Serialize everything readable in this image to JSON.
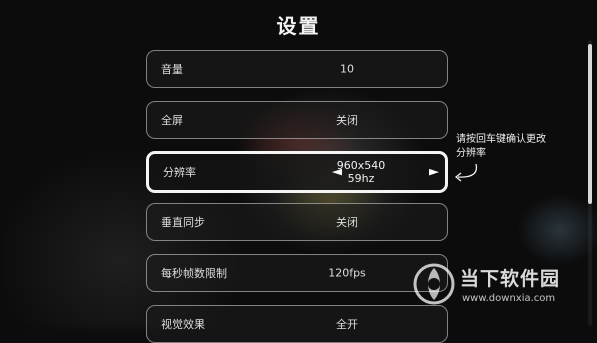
{
  "title": "设置",
  "settings": [
    {
      "label": "音量",
      "value": "10"
    },
    {
      "label": "全屏",
      "value": "关闭"
    },
    {
      "label": "分辨率",
      "value_line1": "960x540",
      "value_line2": "59hz",
      "arrow_left": "◄",
      "arrow_right": "►"
    },
    {
      "label": "垂直同步",
      "value": "关闭"
    },
    {
      "label": "每秒帧数限制",
      "value": "120fps"
    },
    {
      "label": "视觉效果",
      "value": "全开"
    }
  ],
  "hint": {
    "line1": "请按回车键确认更改",
    "line2": "分辨率"
  },
  "watermark": {
    "name": "当下软件园",
    "url": "www.downxia.com"
  }
}
